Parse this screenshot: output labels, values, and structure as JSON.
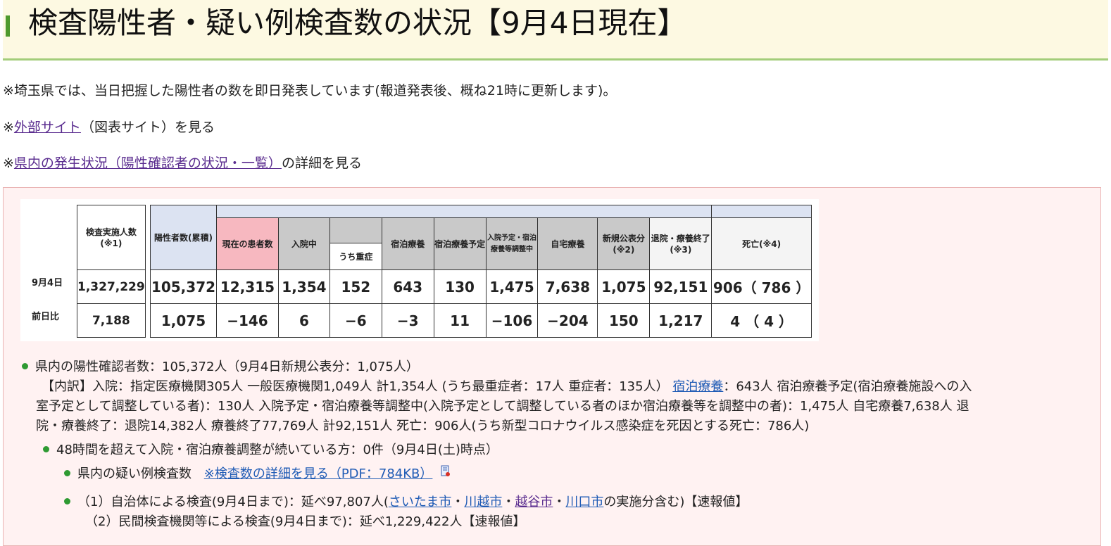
{
  "page": {
    "title": "検査陽性者・疑い例検査数の状況【9月4日現在】"
  },
  "notes": {
    "line1": "※埼玉県では、当日把握した陽性者の数を即日発表しています(報道発表後、概ね21時に更新します)。",
    "line2_prefix": "※",
    "line2_link": "外部サイト",
    "line2_suffix": "（図表サイト）を見る",
    "line3_prefix": "※",
    "line3_link": "県内の発生状況（陽性確認者の状況・一覧）",
    "line3_suffix": "の詳細を見る"
  },
  "table": {
    "headers": {
      "tested": "検査実施人数(※1)",
      "positive": "陽性者数(累積)",
      "current": "現在の患者数",
      "hospitalized": "入院中",
      "severe": "うち重症",
      "hotel": "宿泊療養",
      "hotel_planned": "宿泊療養予定",
      "adjusting": "入院予定・宿泊療養等調整中",
      "home": "自宅療養",
      "new": "新規公表分(※2)",
      "recovered": "退院・療養終了(※3)",
      "deaths": "死亡(※4)"
    },
    "rows": [
      {
        "label": "9月4日",
        "tested": "1,327,229",
        "positive": "105,372",
        "current": "12,315",
        "hospitalized": "1,354",
        "severe": "152",
        "hotel": "643",
        "hotel_planned": "130",
        "adjusting": "1,475",
        "home": "7,638",
        "new": "1,075",
        "recovered": "92,151",
        "deaths": "906（ 786 ）"
      },
      {
        "label": "前日比",
        "tested": "7,188",
        "positive": "1,075",
        "current": "−146",
        "hospitalized": "6",
        "severe": "−6",
        "hotel": "−3",
        "hotel_planned": "11",
        "adjusting": "−106",
        "home": "−204",
        "new": "150",
        "recovered": "1,217",
        "deaths": "4 （ 4 ）"
      }
    ]
  },
  "bullets": {
    "b1": "県内の陽性確認者数：105,372人（9月4日新規公表分：1,075人）",
    "b1_detail_a": "【内訳】入院：指定医療機関305人 一般医療機関1,049人 計1,354人 (うち最重症者：17人 重症者：135人）",
    "b1_detail_link": "宿泊療養",
    "b1_detail_b": "：643人 宿泊療養予定(宿泊療養施設への入",
    "b1_detail_c": "室予定として調整している者)：130人 入院予定・宿泊療養等調整中(入院予定として調整している者のほか宿泊療養等を調整中の者)：1,475人 自宅療養7,638人 退",
    "b1_detail_d": "院・療養終了：退院14,382人 療養終了77,769人 計92,151人 死亡：906人(うち新型コロナウイルス感染症を死因とする死亡：786人)",
    "b2": "48時間を超えて入院・宿泊療養調整が続いている方：0件（9月4日(土)時点）",
    "b3_text": "県内の疑い例検査数",
    "b3_link": "※検査数の詳細を見る（PDF：784KB）",
    "b4_prefix": "（1）自治体による検査(9月4日まで)：延べ97,807人(",
    "b4_link1": "さいたま市",
    "b4_sep": "・",
    "b4_link2": "川越市",
    "b4_link3": "越谷市",
    "b4_link4": "川口市",
    "b4_suffix": "の実施分含む)【速報値】",
    "b5": "（2）民間検査機関等による検査(9月4日まで)：延べ1,229,422人【速報値】"
  },
  "colors": {
    "header_bg": "#fdf9e2",
    "accent_green": "#4f9a2e",
    "panel_bg": "#fff2f2",
    "header_blue": "#dce3f2",
    "header_pink": "#f7b8c0",
    "header_gray": "#c9c9c9",
    "link_purple": "#5a2c8f",
    "link_blue": "#1f5bb5"
  }
}
